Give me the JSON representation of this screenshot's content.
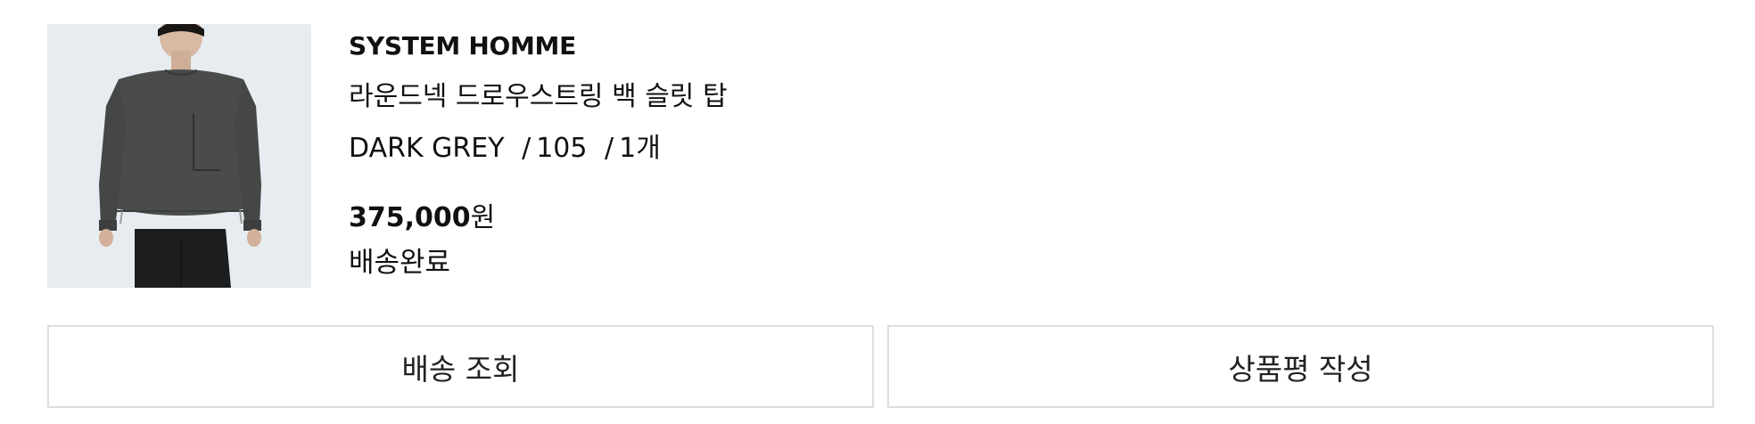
{
  "product": {
    "brand": "SYSTEM HOMME",
    "name": "라운드넥 드로우스트링 백 슬릿 탑",
    "option_color": "DARK GREY",
    "option_size": "105",
    "option_qty": "1개",
    "option_separator": "/",
    "price_amount": "375,000",
    "price_unit": "원",
    "status": "배송완료"
  },
  "actions": {
    "track_delivery_label": "배송 조회",
    "write_review_label": "상품평 작성"
  }
}
